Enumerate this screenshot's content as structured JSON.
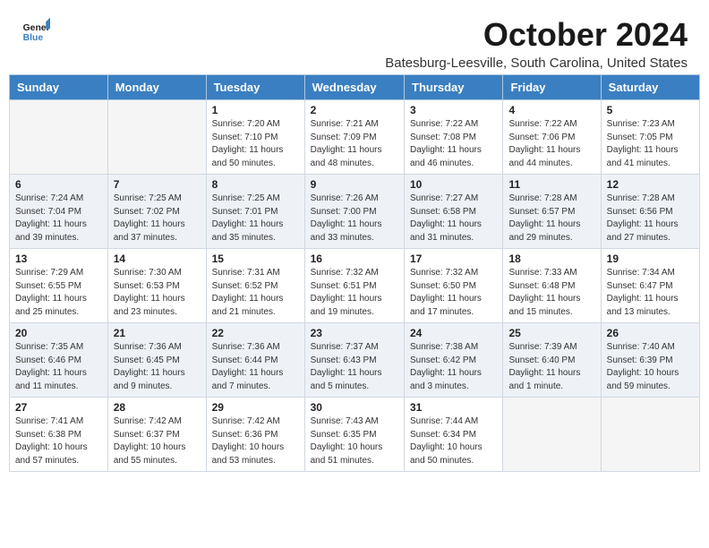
{
  "header": {
    "logo_general": "General",
    "logo_blue": "Blue",
    "month_title": "October 2024",
    "location": "Batesburg-Leesville, South Carolina, United States"
  },
  "days_of_week": [
    "Sunday",
    "Monday",
    "Tuesday",
    "Wednesday",
    "Thursday",
    "Friday",
    "Saturday"
  ],
  "weeks": [
    [
      {
        "day": "",
        "empty": true
      },
      {
        "day": "",
        "empty": true
      },
      {
        "day": "1",
        "sunrise": "Sunrise: 7:20 AM",
        "sunset": "Sunset: 7:10 PM",
        "daylight": "Daylight: 11 hours and 50 minutes."
      },
      {
        "day": "2",
        "sunrise": "Sunrise: 7:21 AM",
        "sunset": "Sunset: 7:09 PM",
        "daylight": "Daylight: 11 hours and 48 minutes."
      },
      {
        "day": "3",
        "sunrise": "Sunrise: 7:22 AM",
        "sunset": "Sunset: 7:08 PM",
        "daylight": "Daylight: 11 hours and 46 minutes."
      },
      {
        "day": "4",
        "sunrise": "Sunrise: 7:22 AM",
        "sunset": "Sunset: 7:06 PM",
        "daylight": "Daylight: 11 hours and 44 minutes."
      },
      {
        "day": "5",
        "sunrise": "Sunrise: 7:23 AM",
        "sunset": "Sunset: 7:05 PM",
        "daylight": "Daylight: 11 hours and 41 minutes."
      }
    ],
    [
      {
        "day": "6",
        "sunrise": "Sunrise: 7:24 AM",
        "sunset": "Sunset: 7:04 PM",
        "daylight": "Daylight: 11 hours and 39 minutes."
      },
      {
        "day": "7",
        "sunrise": "Sunrise: 7:25 AM",
        "sunset": "Sunset: 7:02 PM",
        "daylight": "Daylight: 11 hours and 37 minutes."
      },
      {
        "day": "8",
        "sunrise": "Sunrise: 7:25 AM",
        "sunset": "Sunset: 7:01 PM",
        "daylight": "Daylight: 11 hours and 35 minutes."
      },
      {
        "day": "9",
        "sunrise": "Sunrise: 7:26 AM",
        "sunset": "Sunset: 7:00 PM",
        "daylight": "Daylight: 11 hours and 33 minutes."
      },
      {
        "day": "10",
        "sunrise": "Sunrise: 7:27 AM",
        "sunset": "Sunset: 6:58 PM",
        "daylight": "Daylight: 11 hours and 31 minutes."
      },
      {
        "day": "11",
        "sunrise": "Sunrise: 7:28 AM",
        "sunset": "Sunset: 6:57 PM",
        "daylight": "Daylight: 11 hours and 29 minutes."
      },
      {
        "day": "12",
        "sunrise": "Sunrise: 7:28 AM",
        "sunset": "Sunset: 6:56 PM",
        "daylight": "Daylight: 11 hours and 27 minutes."
      }
    ],
    [
      {
        "day": "13",
        "sunrise": "Sunrise: 7:29 AM",
        "sunset": "Sunset: 6:55 PM",
        "daylight": "Daylight: 11 hours and 25 minutes."
      },
      {
        "day": "14",
        "sunrise": "Sunrise: 7:30 AM",
        "sunset": "Sunset: 6:53 PM",
        "daylight": "Daylight: 11 hours and 23 minutes."
      },
      {
        "day": "15",
        "sunrise": "Sunrise: 7:31 AM",
        "sunset": "Sunset: 6:52 PM",
        "daylight": "Daylight: 11 hours and 21 minutes."
      },
      {
        "day": "16",
        "sunrise": "Sunrise: 7:32 AM",
        "sunset": "Sunset: 6:51 PM",
        "daylight": "Daylight: 11 hours and 19 minutes."
      },
      {
        "day": "17",
        "sunrise": "Sunrise: 7:32 AM",
        "sunset": "Sunset: 6:50 PM",
        "daylight": "Daylight: 11 hours and 17 minutes."
      },
      {
        "day": "18",
        "sunrise": "Sunrise: 7:33 AM",
        "sunset": "Sunset: 6:48 PM",
        "daylight": "Daylight: 11 hours and 15 minutes."
      },
      {
        "day": "19",
        "sunrise": "Sunrise: 7:34 AM",
        "sunset": "Sunset: 6:47 PM",
        "daylight": "Daylight: 11 hours and 13 minutes."
      }
    ],
    [
      {
        "day": "20",
        "sunrise": "Sunrise: 7:35 AM",
        "sunset": "Sunset: 6:46 PM",
        "daylight": "Daylight: 11 hours and 11 minutes."
      },
      {
        "day": "21",
        "sunrise": "Sunrise: 7:36 AM",
        "sunset": "Sunset: 6:45 PM",
        "daylight": "Daylight: 11 hours and 9 minutes."
      },
      {
        "day": "22",
        "sunrise": "Sunrise: 7:36 AM",
        "sunset": "Sunset: 6:44 PM",
        "daylight": "Daylight: 11 hours and 7 minutes."
      },
      {
        "day": "23",
        "sunrise": "Sunrise: 7:37 AM",
        "sunset": "Sunset: 6:43 PM",
        "daylight": "Daylight: 11 hours and 5 minutes."
      },
      {
        "day": "24",
        "sunrise": "Sunrise: 7:38 AM",
        "sunset": "Sunset: 6:42 PM",
        "daylight": "Daylight: 11 hours and 3 minutes."
      },
      {
        "day": "25",
        "sunrise": "Sunrise: 7:39 AM",
        "sunset": "Sunset: 6:40 PM",
        "daylight": "Daylight: 11 hours and 1 minute."
      },
      {
        "day": "26",
        "sunrise": "Sunrise: 7:40 AM",
        "sunset": "Sunset: 6:39 PM",
        "daylight": "Daylight: 10 hours and 59 minutes."
      }
    ],
    [
      {
        "day": "27",
        "sunrise": "Sunrise: 7:41 AM",
        "sunset": "Sunset: 6:38 PM",
        "daylight": "Daylight: 10 hours and 57 minutes."
      },
      {
        "day": "28",
        "sunrise": "Sunrise: 7:42 AM",
        "sunset": "Sunset: 6:37 PM",
        "daylight": "Daylight: 10 hours and 55 minutes."
      },
      {
        "day": "29",
        "sunrise": "Sunrise: 7:42 AM",
        "sunset": "Sunset: 6:36 PM",
        "daylight": "Daylight: 10 hours and 53 minutes."
      },
      {
        "day": "30",
        "sunrise": "Sunrise: 7:43 AM",
        "sunset": "Sunset: 6:35 PM",
        "daylight": "Daylight: 10 hours and 51 minutes."
      },
      {
        "day": "31",
        "sunrise": "Sunrise: 7:44 AM",
        "sunset": "Sunset: 6:34 PM",
        "daylight": "Daylight: 10 hours and 50 minutes."
      },
      {
        "day": "",
        "empty": true
      },
      {
        "day": "",
        "empty": true
      }
    ]
  ]
}
